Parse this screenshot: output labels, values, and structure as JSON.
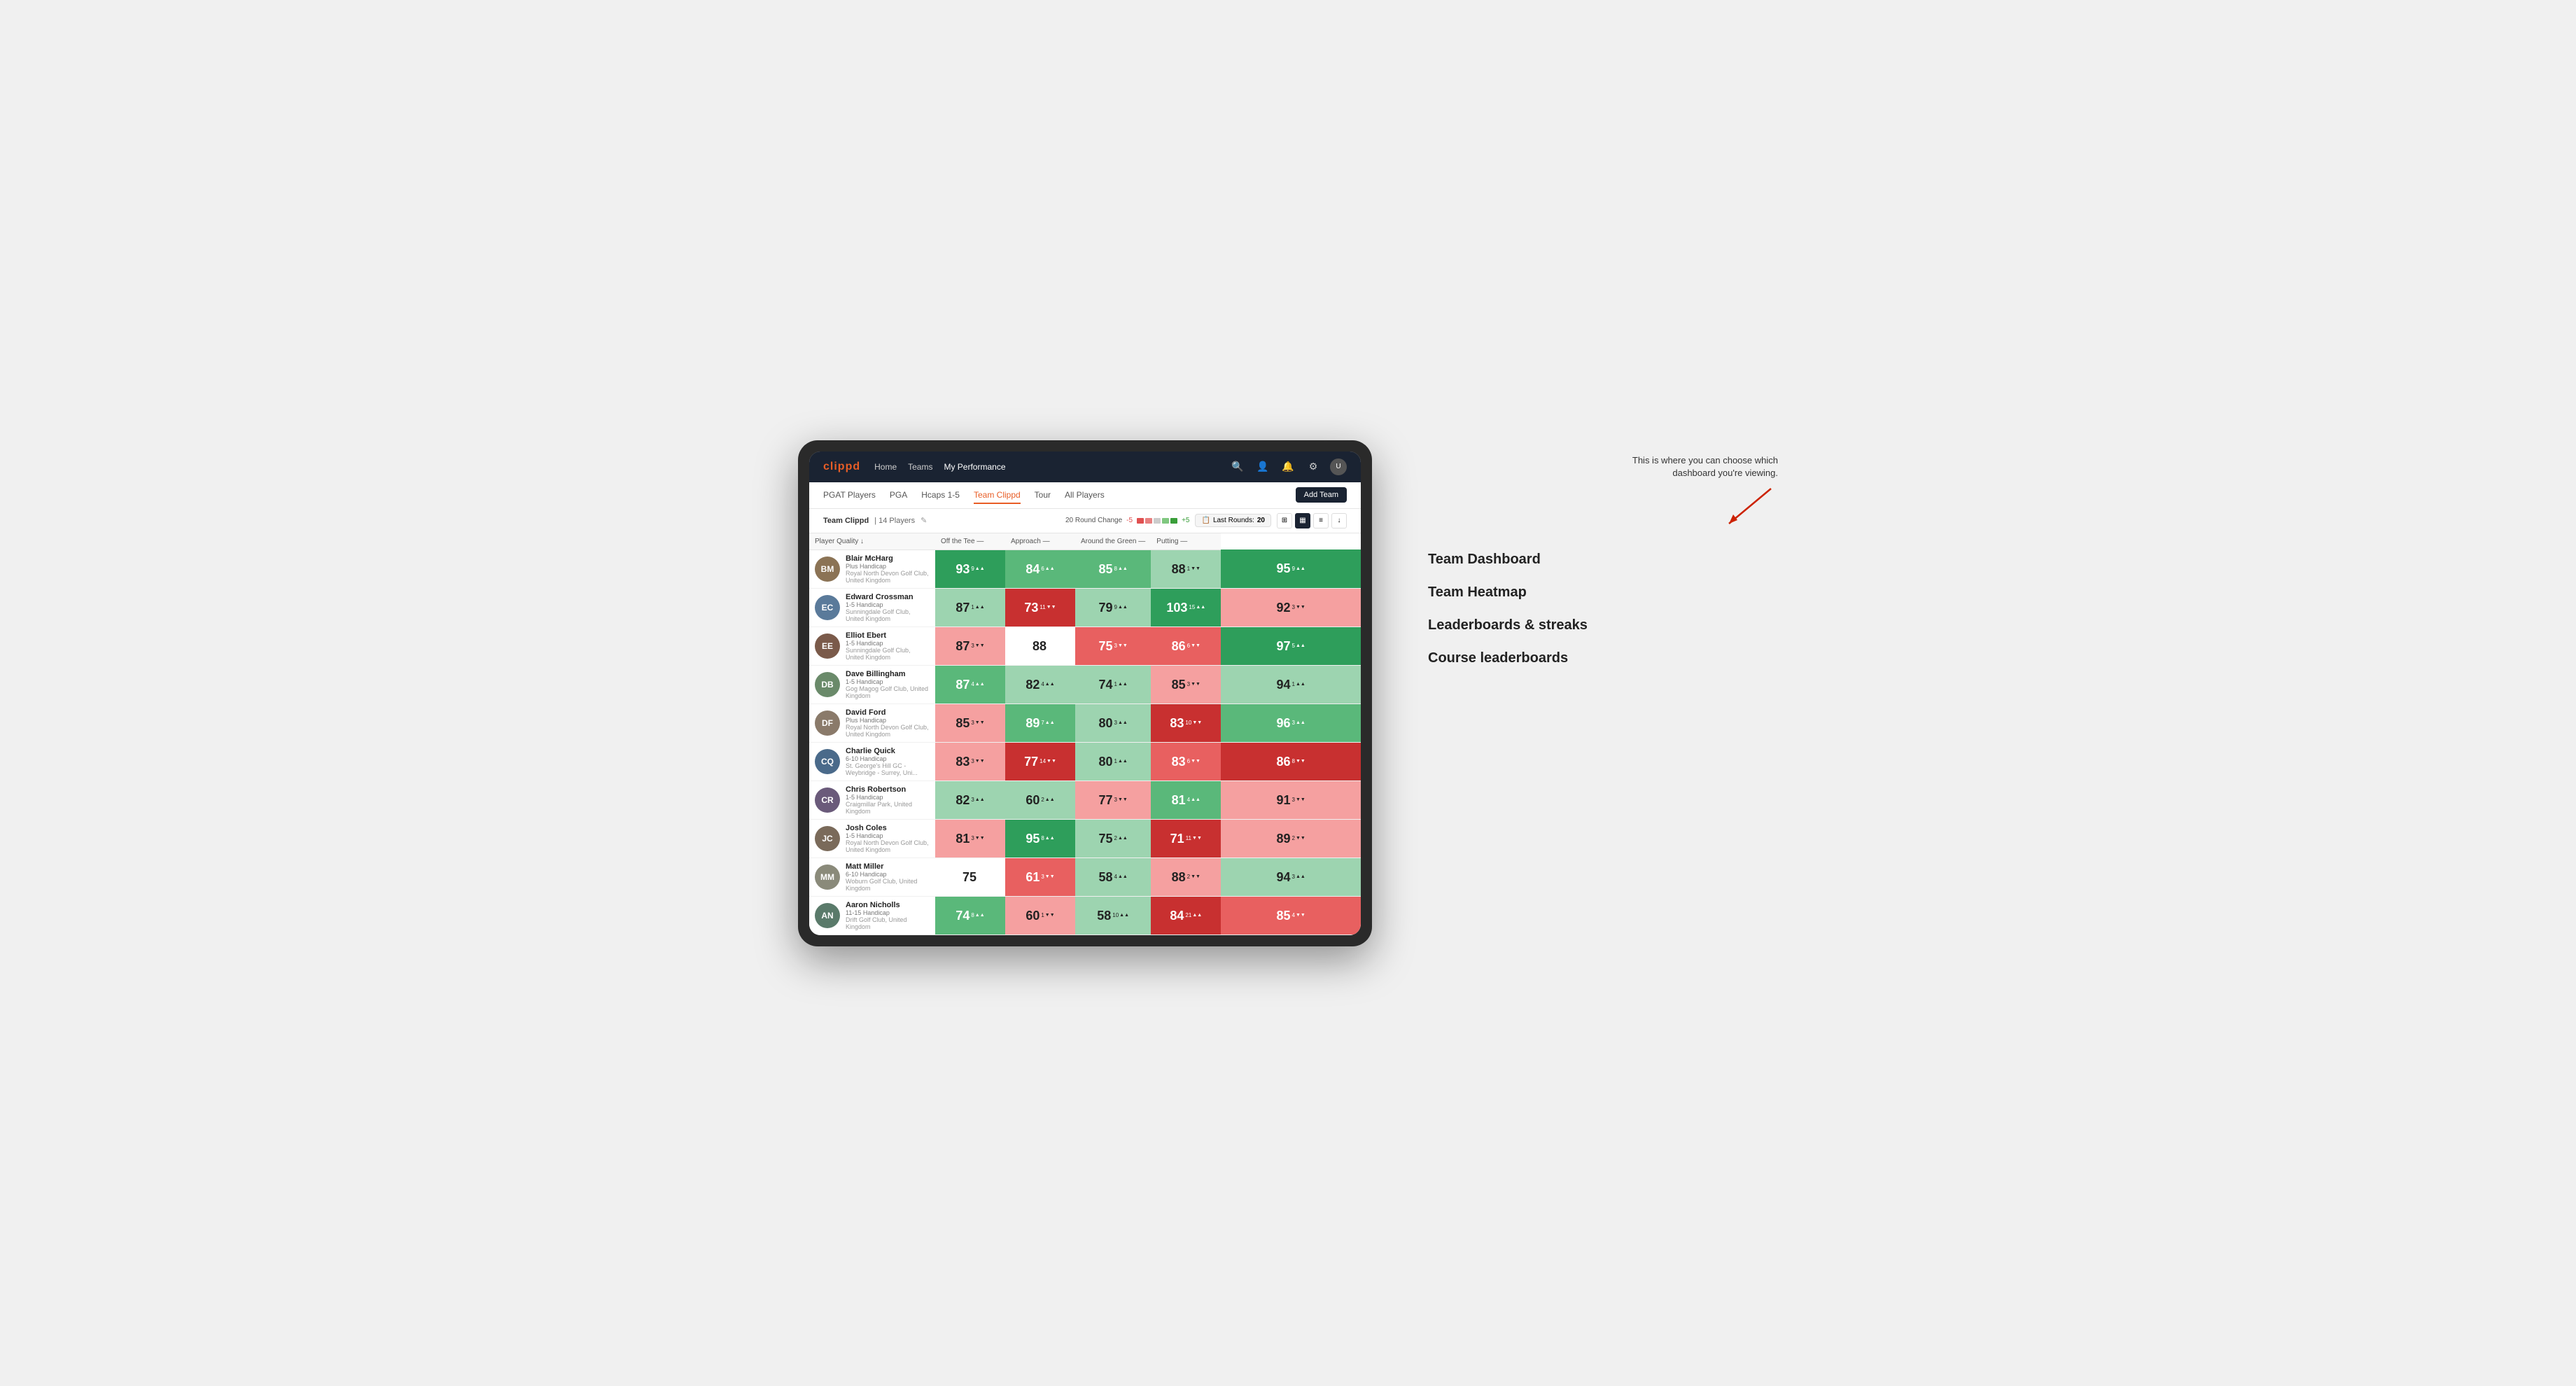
{
  "annotation": {
    "text": "This is where you can choose which dashboard you're viewing.",
    "options": [
      "Team Dashboard",
      "Team Heatmap",
      "Leaderboards & streaks",
      "Course leaderboards"
    ]
  },
  "nav": {
    "logo": "clippd",
    "links": [
      "Home",
      "Teams",
      "My Performance"
    ],
    "active_link": "My Performance"
  },
  "sub_nav": {
    "links": [
      "PGAT Players",
      "PGA",
      "Hcaps 1-5",
      "Team Clippd",
      "Tour",
      "All Players"
    ],
    "active": "Team Clippd",
    "add_team": "Add Team"
  },
  "team_bar": {
    "name": "Team Clippd",
    "separator": "|",
    "count": "14 Players",
    "round_change_label": "20 Round Change",
    "round_change_minus": "-5",
    "round_change_plus": "+5",
    "last_rounds_label": "Last Rounds:",
    "last_rounds_value": "20"
  },
  "table": {
    "headers": {
      "player": "Player Quality ↓",
      "off_tee": "Off the Tee —",
      "approach": "Approach —",
      "around_green": "Around the Green —",
      "putting": "Putting —"
    },
    "rows": [
      {
        "name": "Blair McHarg",
        "handicap": "Plus Handicap",
        "club": "Royal North Devon Golf Club, United Kingdom",
        "avatar_color": "#8B7355",
        "initials": "BM",
        "player_quality": {
          "value": "93",
          "change": "9",
          "dir": "up",
          "color": "green-dark"
        },
        "off_tee": {
          "value": "84",
          "change": "6",
          "dir": "up",
          "color": "green-mid"
        },
        "approach": {
          "value": "85",
          "change": "8",
          "dir": "up",
          "color": "green-mid"
        },
        "around_green": {
          "value": "88",
          "change": "1",
          "dir": "down",
          "color": "green-light"
        },
        "putting": {
          "value": "95",
          "change": "9",
          "dir": "up",
          "color": "green-dark"
        }
      },
      {
        "name": "Edward Crossman",
        "handicap": "1-5 Handicap",
        "club": "Sunningdale Golf Club, United Kingdom",
        "avatar_color": "#5a7a9a",
        "initials": "EC",
        "player_quality": {
          "value": "87",
          "change": "1",
          "dir": "up",
          "color": "green-light"
        },
        "off_tee": {
          "value": "73",
          "change": "11",
          "dir": "down",
          "color": "red-dark"
        },
        "approach": {
          "value": "79",
          "change": "9",
          "dir": "up",
          "color": "green-light"
        },
        "around_green": {
          "value": "103",
          "change": "15",
          "dir": "up",
          "color": "green-dark"
        },
        "putting": {
          "value": "92",
          "change": "3",
          "dir": "down",
          "color": "red-light"
        }
      },
      {
        "name": "Elliot Ebert",
        "handicap": "1-5 Handicap",
        "club": "Sunningdale Golf Club, United Kingdom",
        "avatar_color": "#7a5a4a",
        "initials": "EE",
        "player_quality": {
          "value": "87",
          "change": "3",
          "dir": "down",
          "color": "red-light"
        },
        "off_tee": {
          "value": "88",
          "change": "",
          "dir": "",
          "color": "white-bg"
        },
        "approach": {
          "value": "75",
          "change": "3",
          "dir": "down",
          "color": "red-mid"
        },
        "around_green": {
          "value": "86",
          "change": "6",
          "dir": "down",
          "color": "red-mid"
        },
        "putting": {
          "value": "97",
          "change": "5",
          "dir": "up",
          "color": "green-dark"
        }
      },
      {
        "name": "Dave Billingham",
        "handicap": "1-5 Handicap",
        "club": "Gog Magog Golf Club, United Kingdom",
        "avatar_color": "#6a8a6a",
        "initials": "DB",
        "player_quality": {
          "value": "87",
          "change": "4",
          "dir": "up",
          "color": "green-mid"
        },
        "off_tee": {
          "value": "82",
          "change": "4",
          "dir": "up",
          "color": "green-light"
        },
        "approach": {
          "value": "74",
          "change": "1",
          "dir": "up",
          "color": "green-light"
        },
        "around_green": {
          "value": "85",
          "change": "3",
          "dir": "down",
          "color": "red-light"
        },
        "putting": {
          "value": "94",
          "change": "1",
          "dir": "up",
          "color": "green-light"
        }
      },
      {
        "name": "David Ford",
        "handicap": "Plus Handicap",
        "club": "Royal North Devon Golf Club, United Kingdom",
        "avatar_color": "#8a7a6a",
        "initials": "DF",
        "player_quality": {
          "value": "85",
          "change": "3",
          "dir": "down",
          "color": "red-light"
        },
        "off_tee": {
          "value": "89",
          "change": "7",
          "dir": "up",
          "color": "green-mid"
        },
        "approach": {
          "value": "80",
          "change": "3",
          "dir": "up",
          "color": "green-light"
        },
        "around_green": {
          "value": "83",
          "change": "10",
          "dir": "down",
          "color": "red-dark"
        },
        "putting": {
          "value": "96",
          "change": "3",
          "dir": "up",
          "color": "green-mid"
        }
      },
      {
        "name": "Charlie Quick",
        "handicap": "6-10 Handicap",
        "club": "St. George's Hill GC - Weybridge - Surrey, Uni...",
        "avatar_color": "#4a6a8a",
        "initials": "CQ",
        "player_quality": {
          "value": "83",
          "change": "3",
          "dir": "down",
          "color": "red-light"
        },
        "off_tee": {
          "value": "77",
          "change": "14",
          "dir": "down",
          "color": "red-dark"
        },
        "approach": {
          "value": "80",
          "change": "1",
          "dir": "up",
          "color": "green-light"
        },
        "around_green": {
          "value": "83",
          "change": "6",
          "dir": "down",
          "color": "red-mid"
        },
        "putting": {
          "value": "86",
          "change": "8",
          "dir": "down",
          "color": "red-dark"
        }
      },
      {
        "name": "Chris Robertson",
        "handicap": "1-5 Handicap",
        "club": "Craigmillar Park, United Kingdom",
        "avatar_color": "#6a5a7a",
        "initials": "CR",
        "player_quality": {
          "value": "82",
          "change": "3",
          "dir": "up",
          "color": "green-light"
        },
        "off_tee": {
          "value": "60",
          "change": "2",
          "dir": "up",
          "color": "green-light"
        },
        "approach": {
          "value": "77",
          "change": "3",
          "dir": "down",
          "color": "red-light"
        },
        "around_green": {
          "value": "81",
          "change": "4",
          "dir": "up",
          "color": "green-mid"
        },
        "putting": {
          "value": "91",
          "change": "3",
          "dir": "down",
          "color": "red-light"
        }
      },
      {
        "name": "Josh Coles",
        "handicap": "1-5 Handicap",
        "club": "Royal North Devon Golf Club, United Kingdom",
        "avatar_color": "#7a6a5a",
        "initials": "JC",
        "player_quality": {
          "value": "81",
          "change": "3",
          "dir": "down",
          "color": "red-light"
        },
        "off_tee": {
          "value": "95",
          "change": "8",
          "dir": "up",
          "color": "green-dark"
        },
        "approach": {
          "value": "75",
          "change": "2",
          "dir": "up",
          "color": "green-light"
        },
        "around_green": {
          "value": "71",
          "change": "11",
          "dir": "down",
          "color": "red-dark"
        },
        "putting": {
          "value": "89",
          "change": "2",
          "dir": "down",
          "color": "red-light"
        }
      },
      {
        "name": "Matt Miller",
        "handicap": "6-10 Handicap",
        "club": "Woburn Golf Club, United Kingdom",
        "avatar_color": "#8a8a7a",
        "initials": "MM",
        "player_quality": {
          "value": "75",
          "change": "",
          "dir": "",
          "color": "white-bg"
        },
        "off_tee": {
          "value": "61",
          "change": "3",
          "dir": "down",
          "color": "red-mid"
        },
        "approach": {
          "value": "58",
          "change": "4",
          "dir": "up",
          "color": "green-light"
        },
        "around_green": {
          "value": "88",
          "change": "2",
          "dir": "down",
          "color": "red-light"
        },
        "putting": {
          "value": "94",
          "change": "3",
          "dir": "up",
          "color": "green-light"
        }
      },
      {
        "name": "Aaron Nicholls",
        "handicap": "11-15 Handicap",
        "club": "Drift Golf Club, United Kingdom",
        "avatar_color": "#5a7a6a",
        "initials": "AN",
        "player_quality": {
          "value": "74",
          "change": "8",
          "dir": "up",
          "color": "green-mid"
        },
        "off_tee": {
          "value": "60",
          "change": "1",
          "dir": "down",
          "color": "red-light"
        },
        "approach": {
          "value": "58",
          "change": "10",
          "dir": "up",
          "color": "green-light"
        },
        "around_green": {
          "value": "84",
          "change": "21",
          "dir": "up",
          "color": "red-dark"
        },
        "putting": {
          "value": "85",
          "change": "4",
          "dir": "down",
          "color": "red-mid"
        }
      }
    ]
  }
}
